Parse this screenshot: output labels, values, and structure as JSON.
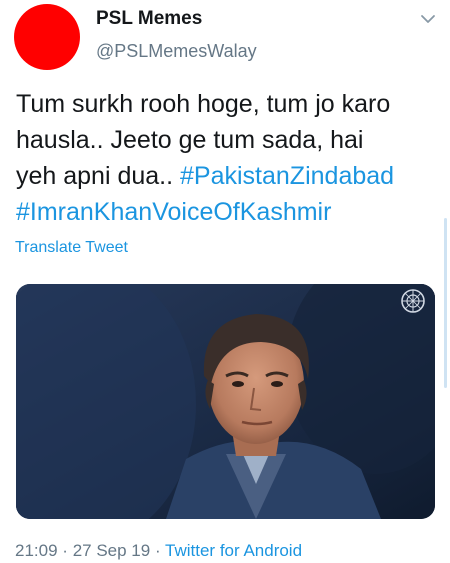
{
  "tweet": {
    "author": {
      "display_name": "PSL Memes",
      "handle": "@PSLMemesWalay",
      "avatar_color": "#ff0000"
    },
    "text_lines": [
      "Tum surkh rooh hoge, tum jo karo",
      "hausla.. Jeeto ge tum sada, hai",
      "yeh apni dua.. "
    ],
    "hashtags": [
      "#PakistanZindabad",
      "#ImranKhanVoiceOfKashmir"
    ],
    "translate_label": "Translate Tweet",
    "media": {
      "icon": "un-emblem-icon"
    },
    "time": "21:09",
    "separator": "·",
    "date": "27 Sep 19",
    "source": "Twitter for Android"
  },
  "colors": {
    "link": "#1b95e0",
    "secondary": "#657786",
    "text": "#14171a"
  }
}
